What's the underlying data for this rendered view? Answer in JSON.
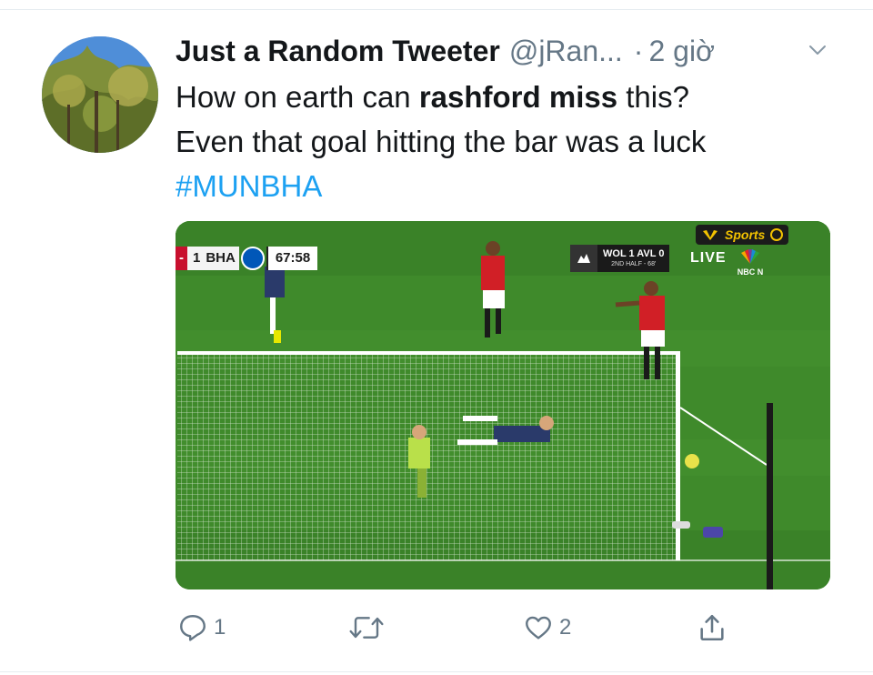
{
  "tweet": {
    "display_name": "Just a Random Tweeter",
    "handle": "@jRan...",
    "separator": "·",
    "time": "2 giờ",
    "text_part1": "How on earth can ",
    "text_bold": "rashford miss",
    "text_part2": " this?",
    "text_line2": "Even that goal hitting the bar was a luck",
    "hashtag": "#MUNBHA"
  },
  "media": {
    "scorebug": {
      "left_prefix": "-",
      "score": "1",
      "team": "BHA",
      "clock": "67:58"
    },
    "other_game": {
      "line": "WOL 1 AVL 0",
      "sub": "2ND HALF - 68'"
    },
    "live_label": "LIVE",
    "broadcaster": "Sports",
    "network": "NBC N"
  },
  "actions": {
    "reply": {
      "icon": "reply-icon",
      "count": "1"
    },
    "retweet": {
      "icon": "retweet-icon",
      "count": ""
    },
    "like": {
      "icon": "heart-icon",
      "count": "2"
    },
    "share": {
      "icon": "share-icon",
      "count": ""
    }
  },
  "colors": {
    "link": "#1da1f2",
    "secondary_text": "#657786",
    "pitch": "#3f8a2b"
  }
}
